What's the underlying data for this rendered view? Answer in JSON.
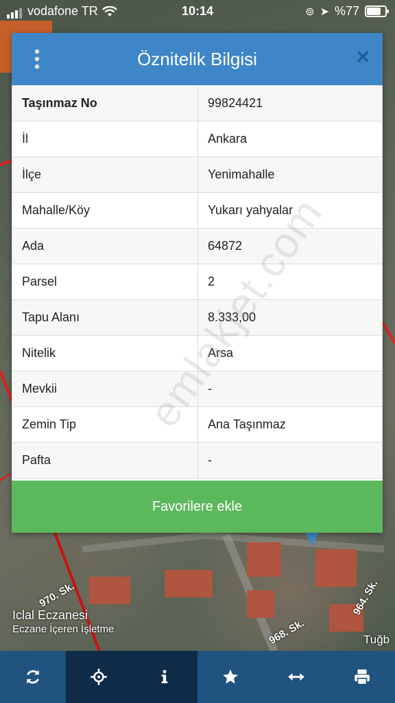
{
  "status_bar": {
    "carrier": "vodafone TR",
    "time": "10:14",
    "battery": "%77"
  },
  "map": {
    "labels": [
      "Iclal Eczanesi",
      "Eczane İçeren İşletme",
      "970. Sk.",
      "968. Sk.",
      "964. Sk.",
      "Tuğb"
    ]
  },
  "dialog": {
    "title": "Öznitelik Bilgisi",
    "rows": [
      {
        "key": "Taşınmaz No",
        "value": "99824421"
      },
      {
        "key": "İl",
        "value": "Ankara"
      },
      {
        "key": "İlçe",
        "value": "Yenimahalle"
      },
      {
        "key": "Mahalle/Köy",
        "value": "Yukarı yahyalar"
      },
      {
        "key": "Ada",
        "value": "64872"
      },
      {
        "key": "Parsel",
        "value": "2"
      },
      {
        "key": "Tapu Alanı",
        "value": "8.333,00"
      },
      {
        "key": "Nitelik",
        "value": "Arsa"
      },
      {
        "key": "Mevkii",
        "value": "-"
      },
      {
        "key": "Zemin Tip",
        "value": "Ana Taşınmaz"
      },
      {
        "key": "Pafta",
        "value": "-"
      }
    ],
    "favorite_button": "Favorilere ekle"
  },
  "watermark": "emlakjet.com",
  "toolbar": {
    "items": [
      "refresh-icon",
      "locate-icon",
      "info-icon",
      "star-icon",
      "measure-icon",
      "print-icon"
    ],
    "active": "info-icon"
  }
}
